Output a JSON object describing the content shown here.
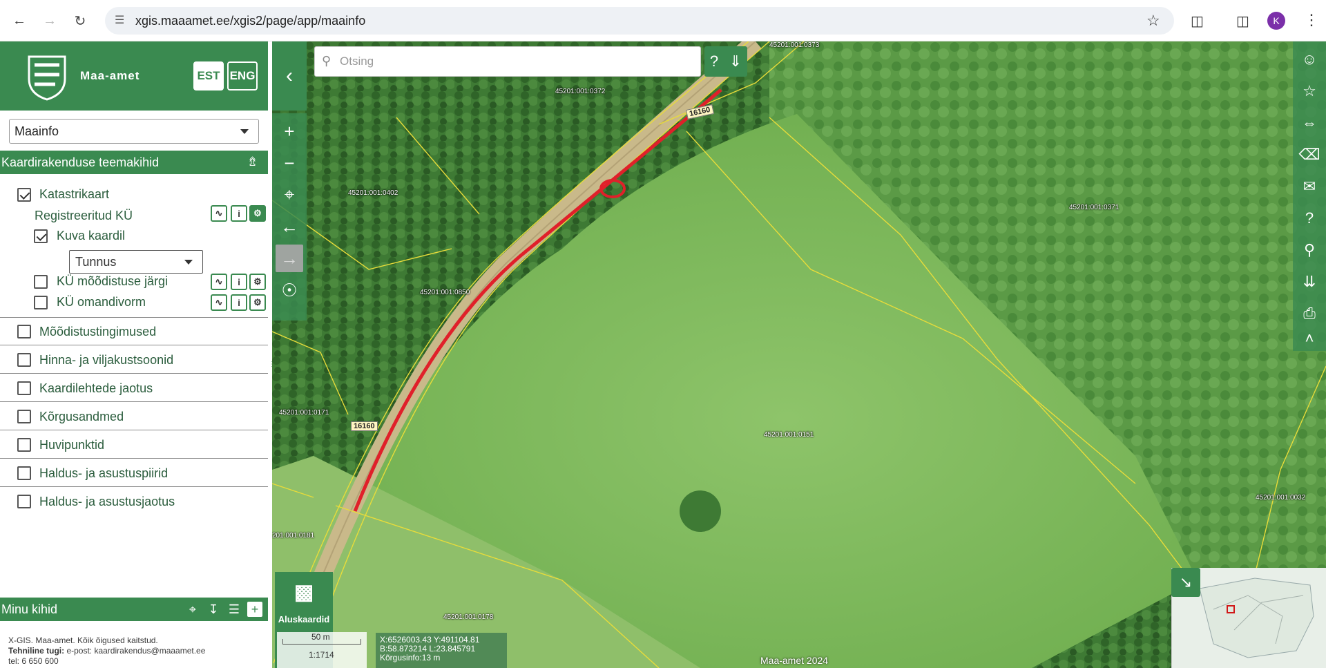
{
  "browser": {
    "url": "xgis.maaamet.ee/xgis2/page/app/maainfo",
    "profile_initial": "K"
  },
  "header": {
    "brand": "Maa-amet",
    "lang_est": "EST",
    "lang_eng": "ENG"
  },
  "app_select": {
    "value": "Maainfo"
  },
  "theme_section": {
    "title": "Kaardirakenduse teemakihid"
  },
  "layers": {
    "katastrikaart": {
      "label": "Katastrikaart",
      "checked": true
    },
    "registreeritud": {
      "label": "Registreeritud KÜ"
    },
    "kuva_kaardil": {
      "label": "Kuva kaardil",
      "checked": true
    },
    "tunnus_select": "Tunnus",
    "mooditus": {
      "label": "KÜ mõõdistuse järgi",
      "checked": false
    },
    "omandivorm": {
      "label": "KÜ omandivorm",
      "checked": false
    },
    "groups": [
      {
        "label": "Mõõdistustingimused",
        "checked": false
      },
      {
        "label": "Hinna- ja viljakustsoonid",
        "checked": false
      },
      {
        "label": "Kaardilehtede jaotus",
        "checked": false
      },
      {
        "label": "Kõrgusandmed",
        "checked": false
      },
      {
        "label": "Huvipunktid",
        "checked": false
      },
      {
        "label": "Haldus- ja asustuspiirid",
        "checked": false
      },
      {
        "label": "Haldus- ja asustusjaotus",
        "checked": false
      }
    ]
  },
  "minu": {
    "title": "Minu kihid"
  },
  "footer": {
    "line1": "X-GIS. Maa-amet. Kõik õigused kaitstud.",
    "line2_bold": "Tehniline tugi:",
    "line2_rest": " e-post: kaardirakendus@maaamet.ee",
    "line3": "tel: 6 650 600"
  },
  "search": {
    "placeholder": "Otsing",
    "help": "?"
  },
  "map": {
    "aluskaardid": "Aluskaardid",
    "scale_distance": "50 m",
    "scale_ratio": "1:1714",
    "coord_line1": "X:6526003.43 Y:491104.81",
    "coord_line2": "B:58.873214 L:23.845791",
    "coord_line3": "Kõrgusinfo:13 m",
    "copyright": "Maa-amet 2024",
    "road_1": "16160",
    "road_2": "16160",
    "parcels": {
      "p373": "45201:001:0373",
      "p372": "45201:001:0372",
      "p402": "45201:001:0402",
      "p371": "45201:001:0371",
      "p850": "45201:001:0850",
      "p171": "45201:001:0171",
      "p151": "45201:001:0151",
      "p181": "201:001:0181",
      "p178": "45201:001:0178",
      "p032": "45201:001:0032"
    }
  }
}
